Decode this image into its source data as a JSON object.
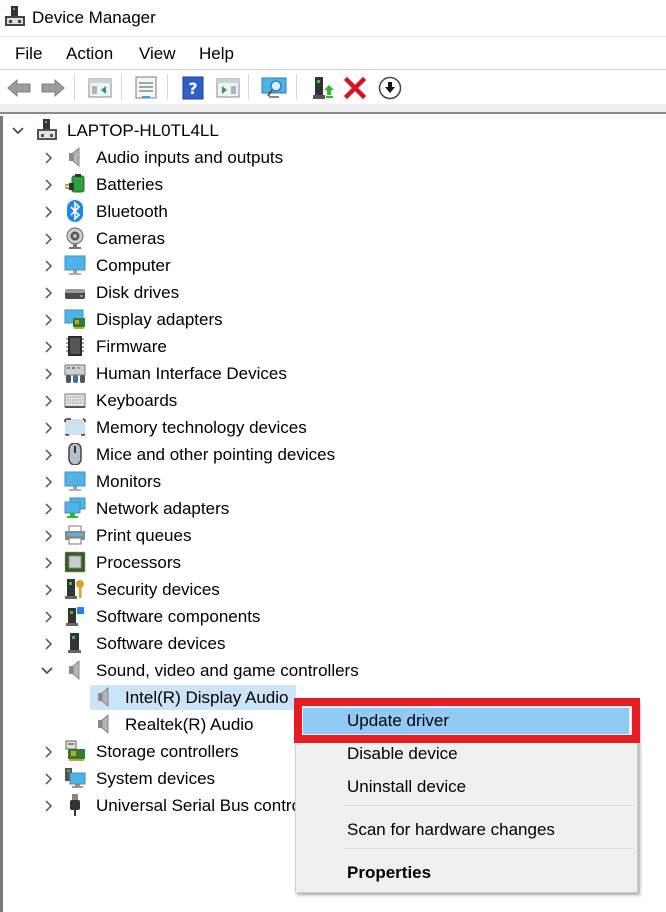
{
  "window": {
    "title": "Device Manager",
    "app_icon": "device-manager-icon"
  },
  "menubar": {
    "items": [
      {
        "label": "File"
      },
      {
        "label": "Action"
      },
      {
        "label": "View"
      },
      {
        "label": "Help"
      }
    ]
  },
  "toolbar": {
    "buttons": [
      {
        "name": "back",
        "icon": "back-arrow-icon"
      },
      {
        "name": "forward",
        "icon": "forward-arrow-icon"
      },
      {
        "name": "show-hide-console-tree",
        "icon": "console-tree-icon"
      },
      {
        "name": "properties",
        "icon": "properties-sheet-icon"
      },
      {
        "name": "help",
        "icon": "help-icon"
      },
      {
        "name": "show-hide-action-pane",
        "icon": "action-pane-icon"
      },
      {
        "name": "scan-hardware",
        "icon": "scan-monitor-icon"
      },
      {
        "name": "update-driver",
        "icon": "update-driver-icon"
      },
      {
        "name": "uninstall",
        "icon": "red-x-icon"
      },
      {
        "name": "disable",
        "icon": "down-arrow-circle-icon"
      }
    ]
  },
  "tree": {
    "root": {
      "label": "LAPTOP-HL0TL4LL",
      "expanded": true,
      "icon": "computer-root-icon"
    },
    "categories": [
      {
        "label": "Audio inputs and outputs",
        "icon": "speaker-icon",
        "expanded": false
      },
      {
        "label": "Batteries",
        "icon": "battery-icon",
        "expanded": false
      },
      {
        "label": "Bluetooth",
        "icon": "bluetooth-icon",
        "expanded": false
      },
      {
        "label": "Cameras",
        "icon": "camera-icon",
        "expanded": false
      },
      {
        "label": "Computer",
        "icon": "monitor-icon",
        "expanded": false
      },
      {
        "label": "Disk drives",
        "icon": "disk-drive-icon",
        "expanded": false
      },
      {
        "label": "Display adapters",
        "icon": "display-adapter-icon",
        "expanded": false
      },
      {
        "label": "Firmware",
        "icon": "firmware-chip-icon",
        "expanded": false
      },
      {
        "label": "Human Interface Devices",
        "icon": "hid-icon",
        "expanded": false
      },
      {
        "label": "Keyboards",
        "icon": "keyboard-icon",
        "expanded": false
      },
      {
        "label": "Memory technology devices",
        "icon": "memory-device-icon",
        "expanded": false
      },
      {
        "label": "Mice and other pointing devices",
        "icon": "mouse-icon",
        "expanded": false
      },
      {
        "label": "Monitors",
        "icon": "monitor-icon",
        "expanded": false
      },
      {
        "label": "Network adapters",
        "icon": "network-icon",
        "expanded": false
      },
      {
        "label": "Print queues",
        "icon": "printer-icon",
        "expanded": false
      },
      {
        "label": "Processors",
        "icon": "processor-icon",
        "expanded": false
      },
      {
        "label": "Security devices",
        "icon": "security-key-icon",
        "expanded": false
      },
      {
        "label": "Software components",
        "icon": "software-component-icon",
        "expanded": false
      },
      {
        "label": "Software devices",
        "icon": "software-device-icon",
        "expanded": false
      },
      {
        "label": "Sound, video and game controllers",
        "icon": "speaker-icon",
        "expanded": true,
        "children": [
          {
            "label": "Intel(R) Display Audio",
            "icon": "speaker-icon",
            "selected": true
          },
          {
            "label": "Realtek(R) Audio",
            "icon": "speaker-icon",
            "selected": false
          }
        ]
      },
      {
        "label": "Storage controllers",
        "icon": "storage-controller-icon",
        "expanded": false
      },
      {
        "label": "System devices",
        "icon": "system-devices-icon",
        "expanded": false
      },
      {
        "label": "Universal Serial Bus controllers",
        "display_label": "Universal Serial Bus contro",
        "icon": "usb-icon",
        "expanded": false
      }
    ]
  },
  "context_menu": {
    "items": [
      {
        "label": "Update driver",
        "highlighted": true
      },
      {
        "label": "Disable device"
      },
      {
        "label": "Uninstall device"
      },
      {
        "separator": true
      },
      {
        "label": "Scan for hardware changes"
      },
      {
        "separator": true
      },
      {
        "label": "Properties",
        "bold": true
      }
    ]
  },
  "annotation": {
    "highlight_color": "#e51c23",
    "target": "Update driver"
  },
  "colors": {
    "selection": "#cce4f7",
    "menu_highlight": "#91c9f7",
    "menu_background": "#f0f0f0"
  }
}
